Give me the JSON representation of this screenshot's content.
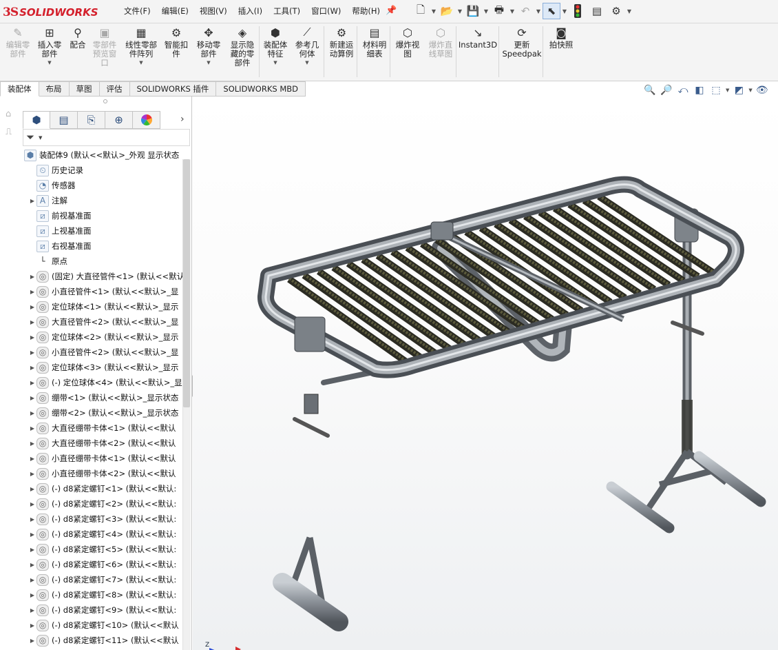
{
  "app": {
    "logo_prefix": "3S",
    "logo_name": "SOLIDWORKS"
  },
  "menus": [
    "文件(F)",
    "编辑(E)",
    "视图(V)",
    "插入(I)",
    "工具(T)",
    "窗口(W)",
    "帮助(H)"
  ],
  "ribbon": {
    "buttons": [
      {
        "label": "编辑零\n部件",
        "icon": "edit-component-icon",
        "glyph": "✎",
        "enabled": false,
        "dropdown": false
      },
      {
        "label": "插入零\n部件",
        "icon": "insert-component-icon",
        "glyph": "⊞",
        "enabled": true,
        "dropdown": true
      },
      {
        "label": "配合",
        "icon": "mate-icon",
        "glyph": "⚲",
        "enabled": true,
        "dropdown": false
      },
      {
        "label": "零部件\n预览窗\n口",
        "icon": "preview-window-icon",
        "glyph": "▣",
        "enabled": false,
        "dropdown": false
      },
      {
        "label": "线性零部\n件阵列",
        "icon": "linear-pattern-icon",
        "glyph": "▦",
        "enabled": true,
        "dropdown": true
      },
      {
        "label": "智能扣\n件",
        "icon": "smart-fastener-icon",
        "glyph": "⚙",
        "enabled": true,
        "dropdown": false
      },
      {
        "label": "移动零\n部件",
        "icon": "move-component-icon",
        "glyph": "✥",
        "enabled": true,
        "dropdown": true
      },
      {
        "label": "显示隐\n藏的零\n部件",
        "icon": "show-hidden-icon",
        "glyph": "◈",
        "enabled": true,
        "dropdown": false
      },
      {
        "label": "装配体\n特征",
        "icon": "assembly-feature-icon",
        "glyph": "⬢",
        "enabled": true,
        "dropdown": true
      },
      {
        "label": "参考几\n何体",
        "icon": "reference-geometry-icon",
        "glyph": "⟋",
        "enabled": true,
        "dropdown": true
      },
      {
        "label": "新建运\n动算例",
        "icon": "motion-study-icon",
        "glyph": "⚙",
        "enabled": true,
        "dropdown": false
      },
      {
        "label": "材料明\n细表",
        "icon": "bom-icon",
        "glyph": "▤",
        "enabled": true,
        "dropdown": false
      },
      {
        "label": "爆炸视\n图",
        "icon": "explode-view-icon",
        "glyph": "⬡",
        "enabled": true,
        "dropdown": false
      },
      {
        "label": "爆炸直\n线草图",
        "icon": "explode-line-icon",
        "glyph": "⬡",
        "enabled": false,
        "dropdown": false
      },
      {
        "label": "Instant3D",
        "icon": "instant3d-icon",
        "glyph": "↘",
        "enabled": true,
        "dropdown": false
      },
      {
        "label": "更新\nSpeedpak",
        "icon": "speedpak-icon",
        "glyph": "⟳",
        "enabled": true,
        "dropdown": false
      },
      {
        "label": "拍快照",
        "icon": "snapshot-icon",
        "glyph": "◙",
        "enabled": true,
        "dropdown": false
      }
    ]
  },
  "tabs": [
    "装配体",
    "布局",
    "草图",
    "评估",
    "SOLIDWORKS 插件",
    "SOLIDWORKS MBD"
  ],
  "active_tab": 0,
  "tree": {
    "root": "装配体9  (默认<<默认>_外观 显示状态",
    "fixed": [
      {
        "label": "历史记录",
        "icon": "history-icon",
        "glyph": "⏲",
        "expandable": false
      },
      {
        "label": "传感器",
        "icon": "sensor-icon",
        "glyph": "◔",
        "expandable": false
      },
      {
        "label": "注解",
        "icon": "annotation-icon",
        "glyph": "A",
        "expandable": true
      },
      {
        "label": "前视基准面",
        "icon": "plane-icon",
        "glyph": "⧄",
        "expandable": false
      },
      {
        "label": "上视基准面",
        "icon": "plane-icon",
        "glyph": "⧄",
        "expandable": false
      },
      {
        "label": "右视基准面",
        "icon": "plane-icon",
        "glyph": "⧄",
        "expandable": false
      },
      {
        "label": "原点",
        "icon": "origin-icon",
        "glyph": "└",
        "expandable": false
      }
    ],
    "components": [
      "(固定) 大直径管件<1> (默认<<默认",
      "小直径管件<1> (默认<<默认>_显",
      "定位球体<1> (默认<<默认>_显示",
      "大直径管件<2> (默认<<默认>_显",
      "定位球体<2> (默认<<默认>_显示",
      "小直径管件<2> (默认<<默认>_显",
      "定位球体<3> (默认<<默认>_显示",
      "(-) 定位球体<4> (默认<<默认>_显",
      "绷带<1> (默认<<默认>_显示状态",
      "绷带<2> (默认<<默认>_显示状态",
      "大直径绷带卡体<1> (默认<<默认",
      "大直径绷带卡体<2> (默认<<默认",
      "小直径绷带卡体<1> (默认<<默认",
      "小直径绷带卡体<2> (默认<<默认",
      "(-) d8紧定螺钉<1> (默认<<默认:",
      "(-) d8紧定螺钉<2> (默认<<默认:",
      "(-) d8紧定螺钉<3> (默认<<默认:",
      "(-) d8紧定螺钉<4> (默认<<默认:",
      "(-) d8紧定螺钉<5> (默认<<默认:",
      "(-) d8紧定螺钉<6> (默认<<默认:",
      "(-) d8紧定螺钉<7> (默认<<默认:",
      "(-) d8紧定螺钉<8> (默认<<默认:",
      "(-) d8紧定螺钉<9> (默认<<默认:",
      "(-) d8紧定螺钉<10> (默认<<默认",
      "(-) d8紧定螺钉<11> (默认<<默认"
    ]
  },
  "triad": {
    "z": "Z"
  },
  "colors": {
    "logo_red": "#d4202c",
    "accent_blue": "#2a6fc9",
    "pipe": "#8f959c",
    "strap": "#5b5a3c"
  }
}
